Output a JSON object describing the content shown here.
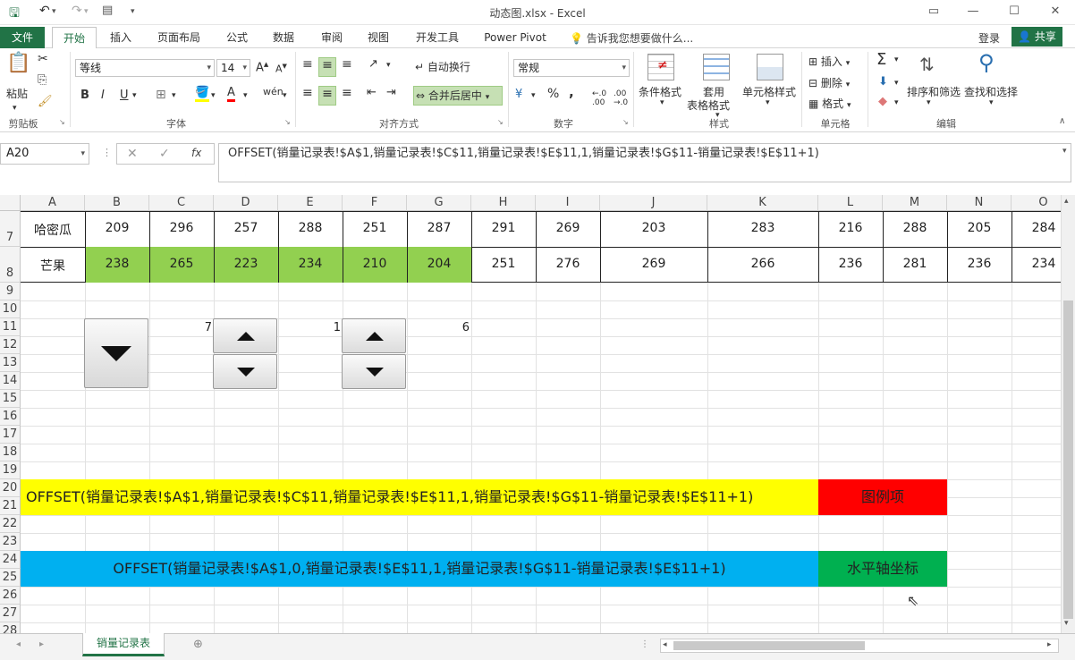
{
  "window": {
    "title": "动态图.xlsx - Excel"
  },
  "tabs": {
    "file": "文件",
    "home": "开始",
    "insert": "插入",
    "page_layout": "页面布局",
    "formulas": "公式",
    "data": "数据",
    "review": "审阅",
    "view": "视图",
    "developer": "开发工具",
    "power_pivot": "Power Pivot",
    "tell_me": "告诉我您想要做什么...",
    "login": "登录",
    "share": "共享"
  },
  "ribbon": {
    "clipboard": {
      "label": "剪贴板",
      "paste": "粘贴"
    },
    "font": {
      "label": "字体",
      "family": "等线",
      "size": "14",
      "bold": "B",
      "italic": "I",
      "underline": "U"
    },
    "alignment": {
      "label": "对齐方式",
      "wrap": "自动换行",
      "merge": "合并后居中"
    },
    "number": {
      "label": "数字",
      "format": "常规",
      "percent": "%",
      "comma": ","
    },
    "styles": {
      "label": "样式",
      "conditional": "条件格式",
      "table_format_1": "套用",
      "table_format_2": "表格格式",
      "cell_styles": "单元格样式"
    },
    "cells": {
      "label": "单元格",
      "insert": "插入",
      "delete": "删除",
      "format": "格式"
    },
    "editing": {
      "label": "编辑",
      "sort": "排序和筛选",
      "find": "查找和选择"
    }
  },
  "formula_bar": {
    "name_box": "A20",
    "fx": "fx",
    "formula": "OFFSET(销量记录表!$A$1,销量记录表!$C$11,销量记录表!$E$11,1,销量记录表!$G$11-销量记录表!$E$11+1)"
  },
  "columns": [
    "A",
    "B",
    "C",
    "D",
    "E",
    "F",
    "G",
    "H",
    "I",
    "J",
    "K",
    "L",
    "M",
    "N",
    "O"
  ],
  "rows": {
    "labels": [
      "7",
      "8",
      "9",
      "10",
      "11",
      "12",
      "13",
      "14",
      "15",
      "16",
      "17",
      "18",
      "19",
      "20",
      "21",
      "22",
      "23",
      "24",
      "25",
      "26",
      "27",
      "28"
    ]
  },
  "data_rows": [
    {
      "name": "哈密瓜",
      "values": [
        "209",
        "296",
        "257",
        "288",
        "251",
        "287",
        "291",
        "269",
        "203",
        "283",
        "216",
        "288",
        "205",
        "284"
      ]
    },
    {
      "name": "芒果",
      "values": [
        "238",
        "265",
        "223",
        "234",
        "210",
        "204",
        "251",
        "276",
        "269",
        "266",
        "236",
        "281",
        "236",
        "234"
      ]
    }
  ],
  "controls": {
    "c11": "7",
    "e11": "1",
    "g11": "6"
  },
  "formula_cells": {
    "series": "OFFSET(销量记录表!$A$1,销量记录表!$C$11,销量记录表!$E$11,1,销量记录表!$G$11-销量记录表!$E$11+1)",
    "legend": "图例项",
    "axis": "OFFSET(销量记录表!$A$1,0,销量记录表!$E$11,1,销量记录表!$G$11-销量记录表!$E$11+1)",
    "axis_label": "水平轴坐标"
  },
  "sheet_tabs": [
    "销量记录表"
  ],
  "colors": {
    "excel_green": "#217346",
    "highlight_green": "#92d050",
    "yellow": "#ffff00",
    "red": "#ff0000",
    "blue": "#00b0f0",
    "green": "#00b050"
  }
}
